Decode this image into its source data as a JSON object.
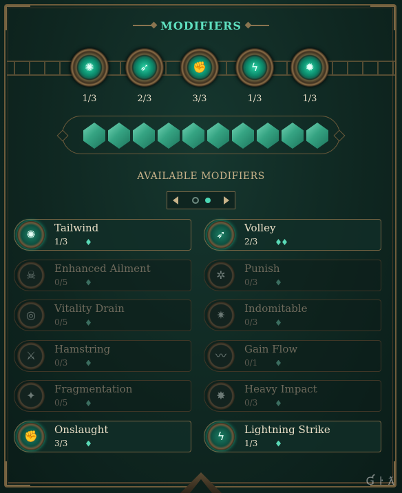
{
  "header": {
    "title": "MODIFIERS"
  },
  "slots": [
    {
      "icon": "wind-feathers-icon",
      "glyph": "✺",
      "count": "1/3"
    },
    {
      "icon": "volley-arrows-icon",
      "glyph": "➶",
      "count": "2/3"
    },
    {
      "icon": "fist-plus-icon",
      "glyph": "✊",
      "count": "3/3"
    },
    {
      "icon": "lightning-strike-icon",
      "glyph": "ϟ",
      "count": "1/3"
    },
    {
      "icon": "burst-icon",
      "glyph": "✹",
      "count": "1/3"
    }
  ],
  "gems": {
    "filled": 10,
    "total": 10
  },
  "available": {
    "title": "AVAILABLE MODIFIERS",
    "page": 2,
    "page_count": 2
  },
  "modifiers_left": [
    {
      "name": "Tailwind",
      "count": "1/3",
      "pips": 1,
      "active": true,
      "icon": "wind-feathers-icon",
      "glyph": "✺"
    },
    {
      "name": "Enhanced Ailment",
      "count": "0/5",
      "pips": 1,
      "active": false,
      "icon": "skull-plus-icon",
      "glyph": "☠"
    },
    {
      "name": "Vitality Drain",
      "count": "0/5",
      "pips": 1,
      "active": false,
      "icon": "drain-ring-icon",
      "glyph": "◎"
    },
    {
      "name": "Hamstring",
      "count": "0/3",
      "pips": 1,
      "active": false,
      "icon": "slash-icon",
      "glyph": "⚔"
    },
    {
      "name": "Fragmentation",
      "count": "0/5",
      "pips": 1,
      "active": false,
      "icon": "shatter-icon",
      "glyph": "✦"
    },
    {
      "name": "Onslaught",
      "count": "3/3",
      "pips": 1,
      "active": true,
      "icon": "fist-plus-icon",
      "glyph": "✊"
    }
  ],
  "modifiers_right": [
    {
      "name": "Volley",
      "count": "2/3",
      "pips": 2,
      "active": true,
      "icon": "volley-arrows-icon",
      "glyph": "➶"
    },
    {
      "name": "Punish",
      "count": "0/3",
      "pips": 1,
      "active": false,
      "icon": "target-icon",
      "glyph": "✲"
    },
    {
      "name": "Indomitable",
      "count": "0/3",
      "pips": 1,
      "active": false,
      "icon": "sun-shield-icon",
      "glyph": "✷"
    },
    {
      "name": "Gain Flow",
      "count": "0/1",
      "pips": 1,
      "active": false,
      "icon": "flow-icon",
      "glyph": "〰"
    },
    {
      "name": "Heavy Impact",
      "count": "0/3",
      "pips": 1,
      "active": false,
      "icon": "impact-icon",
      "glyph": "✸"
    },
    {
      "name": "Lightning Strike",
      "count": "1/3",
      "pips": 1,
      "active": true,
      "icon": "lightning-strike-icon",
      "glyph": "ϟ"
    }
  ],
  "watermark": "Ɠ ŀ ƛ",
  "colors": {
    "accent": "#4bd8b4",
    "gold": "#c9b38a",
    "background": "#0f2721"
  }
}
